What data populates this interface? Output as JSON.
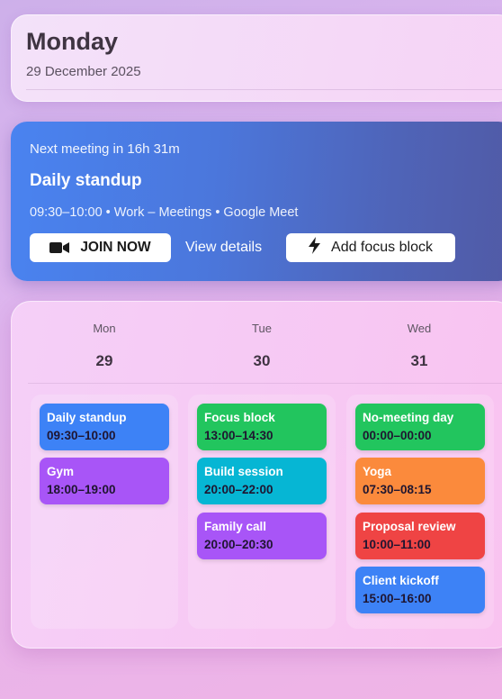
{
  "header": {
    "day": "Monday",
    "date": "29 December 2025"
  },
  "meeting": {
    "next_label": "Next meeting in 16h 31m",
    "title": "Daily standup",
    "meta": "09:30–10:00 • Work – Meetings • Google Meet",
    "join_label": "JOIN NOW",
    "details_label": "View details",
    "focus_label": "Add focus block",
    "colors": {
      "gradient_start": "#4a83f0",
      "gradient_end": "#515aa5"
    }
  },
  "calendar": {
    "days": [
      {
        "dow": "Mon",
        "num": "29",
        "events": [
          {
            "title": "Daily standup",
            "time": "09:30–10:00",
            "color": "#3d82f6"
          },
          {
            "title": "Gym",
            "time": "18:00–19:00",
            "color": "#a855f7"
          }
        ]
      },
      {
        "dow": "Tue",
        "num": "30",
        "events": [
          {
            "title": "Focus block",
            "time": "13:00–14:30",
            "color": "#22c55e"
          },
          {
            "title": "Build session",
            "time": "20:00–22:00",
            "color": "#06b6d4"
          },
          {
            "title": "Family call",
            "time": "20:00–20:30",
            "color": "#a855f7"
          }
        ]
      },
      {
        "dow": "Wed",
        "num": "31",
        "events": [
          {
            "title": "No-meeting day",
            "time": "00:00–00:00",
            "color": "#22c55e"
          },
          {
            "title": "Yoga",
            "time": "07:30–08:15",
            "color": "#fb8a3c"
          },
          {
            "title": "Proposal review",
            "time": "10:00–11:00",
            "color": "#ef4444"
          },
          {
            "title": "Client kickoff",
            "time": "15:00–16:00",
            "color": "#3d82f6"
          }
        ]
      }
    ]
  }
}
